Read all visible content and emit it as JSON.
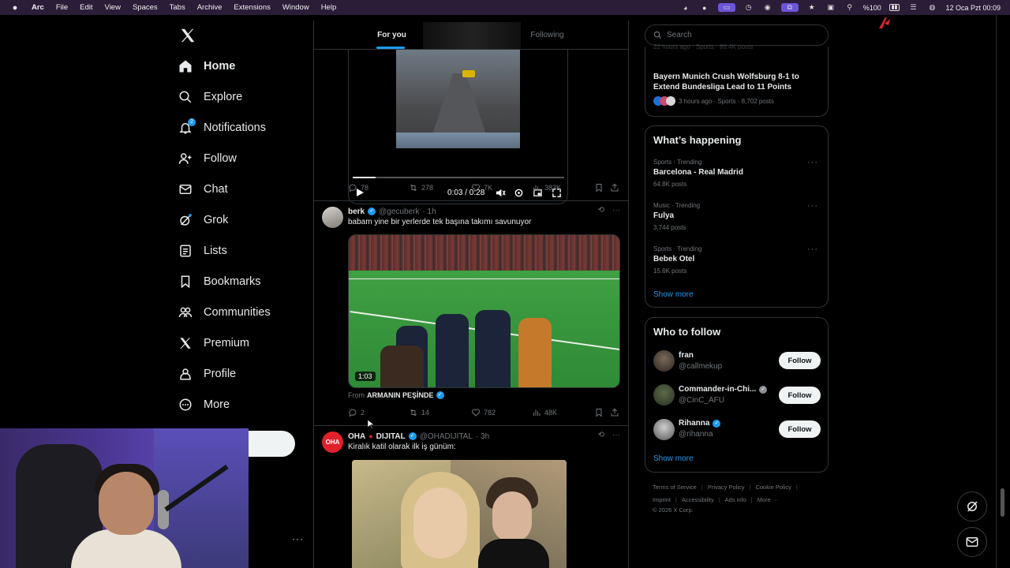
{
  "menubar": {
    "app": "Arc",
    "items": [
      "File",
      "Edit",
      "View",
      "Spaces",
      "Tabs",
      "Archive",
      "Extensions",
      "Window",
      "Help"
    ],
    "battery": "%100",
    "clock": "12 Oca Pzt  00:09"
  },
  "nav": {
    "items": [
      {
        "label": "Home",
        "icon": "home-icon"
      },
      {
        "label": "Explore",
        "icon": "search-icon"
      },
      {
        "label": "Notifications",
        "icon": "bell-icon",
        "badge": "2"
      },
      {
        "label": "Follow",
        "icon": "follow-icon"
      },
      {
        "label": "Chat",
        "icon": "mail-icon"
      },
      {
        "label": "Grok",
        "icon": "grok-icon"
      },
      {
        "label": "Lists",
        "icon": "list-icon"
      },
      {
        "label": "Bookmarks",
        "icon": "bookmark-icon"
      },
      {
        "label": "Communities",
        "icon": "communities-icon"
      },
      {
        "label": "Premium",
        "icon": "x-icon"
      },
      {
        "label": "Profile",
        "icon": "person-icon"
      },
      {
        "label": "More",
        "icon": "more-circle-icon"
      }
    ]
  },
  "timeline": {
    "tabs": [
      "For you",
      "Following"
    ],
    "video1": {
      "time": "0:03 / 0:28",
      "progress": 0.107,
      "stats": {
        "replies": "78",
        "reposts": "278",
        "likes": "7K",
        "views": "383K"
      }
    },
    "tweet2": {
      "name": "berk",
      "handle": "@gecuberk",
      "time": "· 1h",
      "text": "babam yine bir yerlerde tek başına takımı savunuyor",
      "duration": "1:03",
      "from_prefix": "From",
      "from_name": "ARMANIN PEŞİNDE",
      "stats": {
        "replies": "2",
        "reposts": "14",
        "likes": "782",
        "views": "48K"
      }
    },
    "tweet3": {
      "name": "OHA",
      "name_suffix": "DIJITAL",
      "avatar_text": "OHA",
      "handle": "@OHADIJITAL",
      "time": "· 3h",
      "text": "Kiralık katil olarak ilk iş günüm:"
    }
  },
  "search": {
    "placeholder": "Search"
  },
  "top_trend": {
    "meta_partial": "22 hours ago · Sports · 89.4K posts",
    "title": "Bayern Munich Crush Wolfsburg 8-1 to Extend Bundesliga Lead to 11 Points",
    "meta": "3 hours ago · Sports · 8,702 posts"
  },
  "happening": {
    "title": "What’s happening",
    "trends": [
      {
        "cat": "Sports · Trending",
        "name": "Barcelona - Real Madrid",
        "posts": "64.8K posts"
      },
      {
        "cat": "Music · Trending",
        "name": "Fulya",
        "posts": "3,744 posts"
      },
      {
        "cat": "Sports · Trending",
        "name": "Bebek Otel",
        "posts": "15.6K posts"
      }
    ],
    "show_more": "Show more"
  },
  "who_to_follow": {
    "title": "Who to follow",
    "people": [
      {
        "name": "fran",
        "handle": "@callmekup",
        "verified": false
      },
      {
        "name": "Commander-in-Chi...",
        "handle": "@CinC_AFU",
        "verified": true
      },
      {
        "name": "Rihanna",
        "handle": "@rihanna",
        "verified": true
      }
    ],
    "follow_label": "Follow",
    "show_more": "Show more"
  },
  "footer": {
    "row1": [
      "Terms of Service",
      "Privacy Policy",
      "Cookie Policy"
    ],
    "row2": [
      "Imprint",
      "Accessibility",
      "Ads info",
      "More ···"
    ],
    "copyright": "© 2026 X Corp."
  },
  "colors": {
    "accent": "#1d9bf0",
    "bg": "#000000",
    "text": "#e7e9ea",
    "muted": "#71767b",
    "border": "#2f3336"
  }
}
